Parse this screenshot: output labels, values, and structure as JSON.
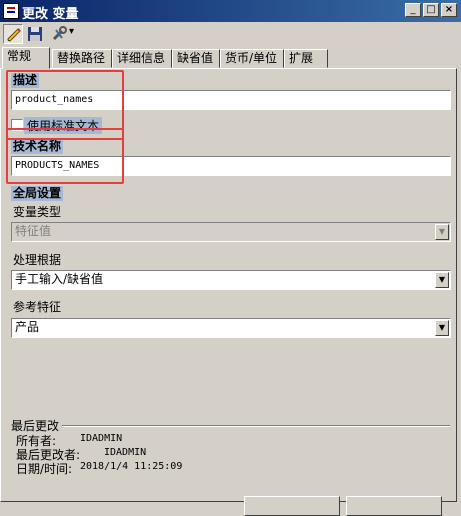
{
  "window": {
    "title": "更改 变量",
    "minimize_glyph": "_",
    "maximize_glyph": "□",
    "close_glyph": "×"
  },
  "toolbar": {
    "edit_icon": "pencil-edit-icon",
    "save_icon": "floppy-save-icon",
    "tools_icon": "wrench-tools-icon",
    "dropdown_glyph": "▾"
  },
  "tabs": [
    "常规",
    "替换路径",
    "详细信息",
    "缺省值",
    "货币/单位",
    "扩展"
  ],
  "general": {
    "description_label": "描述",
    "description_value": "product_names",
    "use_standard_text_label": "使用标准文本",
    "use_standard_text_checked": false,
    "technical_name_label": "技术名称",
    "technical_name_value": "PRODUCTS_NAMES"
  },
  "global_settings": {
    "header": "全局设置",
    "variable_type_label": "变量类型",
    "variable_type_value": "特征值",
    "processing_by_label": "处理根据",
    "processing_by_value": "手工输入/缺省值",
    "reference_char_label": "参考特征",
    "reference_char_value": "产品"
  },
  "last_changed": {
    "header": "最后更改",
    "owner_label": "所有者:",
    "owner_value": "IDADMIN",
    "last_changed_by_label": "最后更改者:",
    "last_changed_by_value": "IDADMIN",
    "datetime_label": "日期/时间:",
    "datetime_value": "2018/1/4 11:25:09"
  },
  "colors": {
    "titlebar_start": "#0a246a",
    "titlebar_end": "#3a6ea5",
    "highlight_box": "#e04040",
    "section_header_bg": "#a6b8d4"
  }
}
